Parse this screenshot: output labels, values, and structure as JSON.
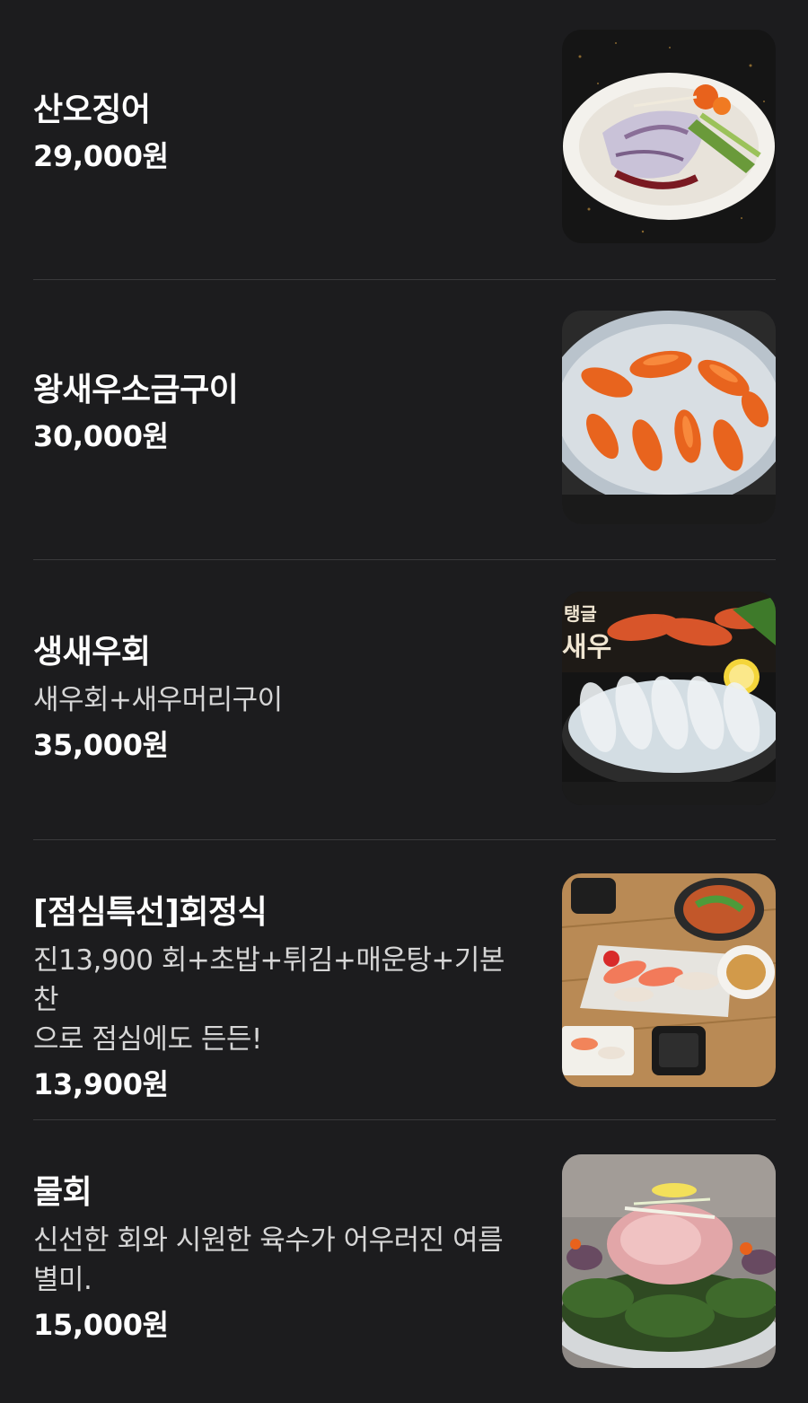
{
  "menu": {
    "items": [
      {
        "name": "산오징어",
        "description": "",
        "price": "29,000원",
        "image": "squid-plate-photo"
      },
      {
        "name": "왕새우소금구이",
        "description": "",
        "price": "30,000원",
        "image": "grilled-prawns-photo"
      },
      {
        "name": "생새우회",
        "description": "새우회+새우머리구이",
        "price": "35,000원",
        "image": "raw-shrimp-photo",
        "image_text": [
          "탱글",
          "새우"
        ]
      },
      {
        "name": "[점심특선]회정식",
        "description": "진13,900 회+초밥+튀김+매운탕+기본찬\n으로 점심에도 든든!",
        "price": "13,900원",
        "image": "sashimi-set-photo"
      },
      {
        "name": "물회",
        "description": "신선한 회와 시원한 육수가 어우러진 여름\n별미.",
        "price": "15,000원",
        "image": "mulhoe-bowl-photo"
      }
    ]
  },
  "colors": {
    "background": "#1c1c1e",
    "divider": "#3a3a3c",
    "text_primary": "#ffffff",
    "text_secondary": "#d6d6d6"
  }
}
